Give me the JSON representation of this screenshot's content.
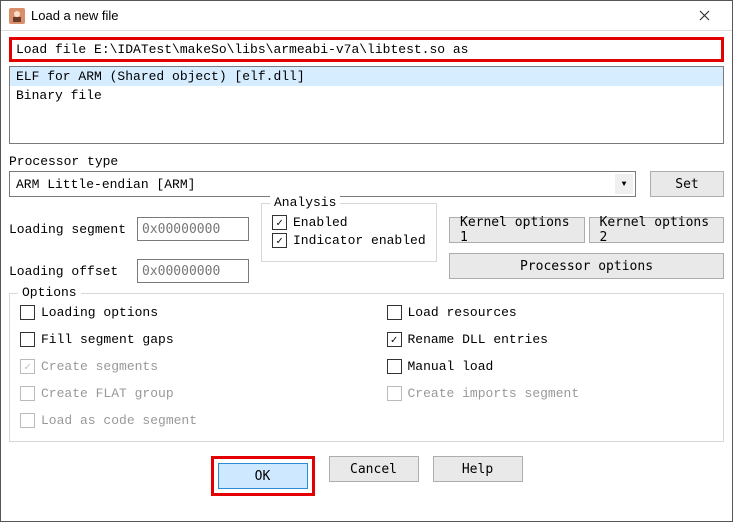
{
  "titlebar": {
    "title": "Load a new file"
  },
  "load_path": "Load file E:\\IDATest\\makeSo\\libs\\armeabi-v7a\\libtest.so as",
  "file_formats": {
    "items": [
      "ELF for ARM (Shared object) [elf.dll]",
      "Binary file"
    ]
  },
  "processor": {
    "label": "Processor type",
    "value": "ARM Little-endian [ARM]",
    "set_button": "Set"
  },
  "segments": {
    "loading_segment_label": "Loading segment",
    "loading_segment_value": "0x00000000",
    "loading_offset_label": "Loading offset",
    "loading_offset_value": "0x00000000"
  },
  "analysis": {
    "legend": "Analysis",
    "enabled_label": "Enabled",
    "indicator_label": "Indicator enabled"
  },
  "kernel": {
    "opt1": "Kernel options 1",
    "opt2": "Kernel options 2",
    "proc_opts": "Processor options"
  },
  "options": {
    "legend": "Options",
    "loading_options": "Loading options",
    "fill_gaps": "Fill segment gaps",
    "create_segments": "Create segments",
    "create_flat": "Create FLAT group",
    "load_as_code": "Load as code segment",
    "load_resources": "Load resources",
    "rename_dll": "Rename DLL entries",
    "manual_load": "Manual load",
    "create_imports": "Create imports segment"
  },
  "buttons": {
    "ok": "OK",
    "cancel": "Cancel",
    "help": "Help"
  }
}
